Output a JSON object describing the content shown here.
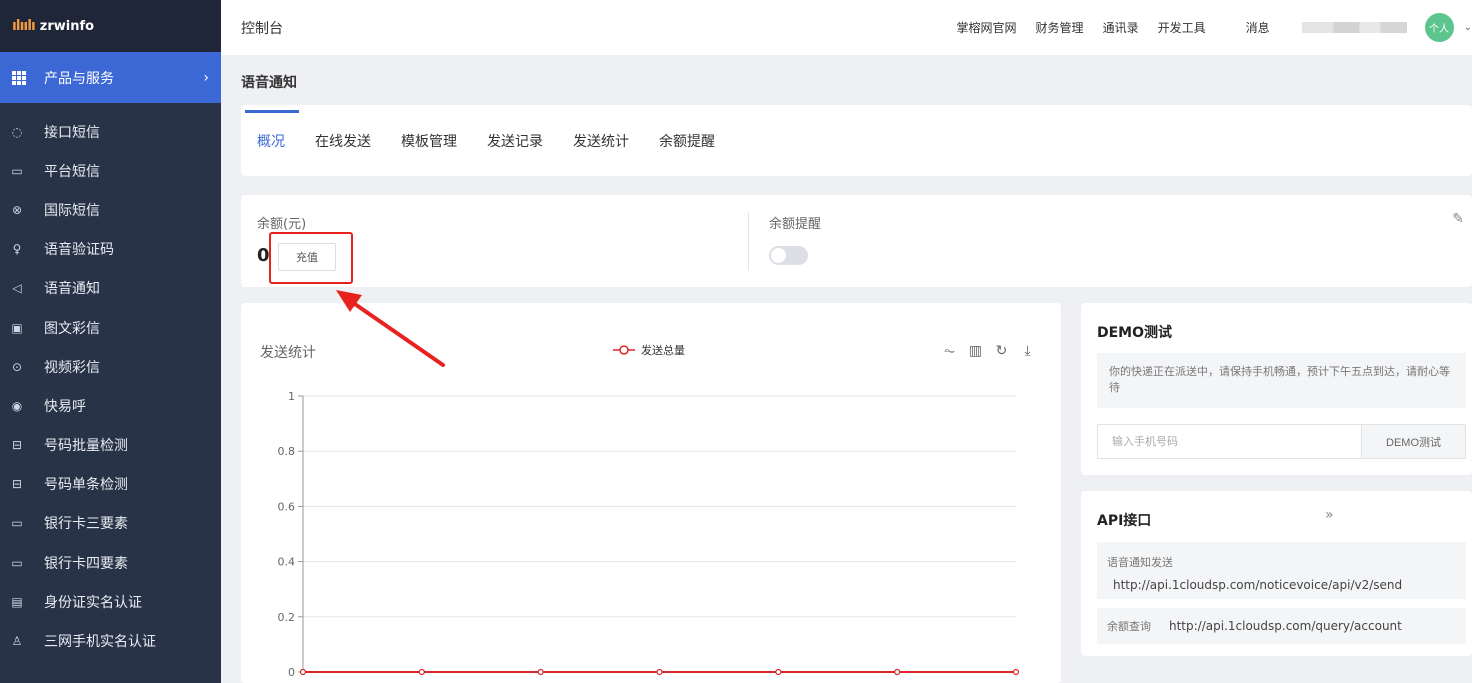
{
  "app": {
    "logo_text": "zrwinfo",
    "logo_mark": "||||H"
  },
  "sidebar": {
    "section_label": "产品与服务",
    "items": [
      {
        "label": "接口短信",
        "icon": "message-circle-icon"
      },
      {
        "label": "平台短信",
        "icon": "chat-square-icon"
      },
      {
        "label": "国际短信",
        "icon": "globe-icon"
      },
      {
        "label": "语音验证码",
        "icon": "microphone-icon"
      },
      {
        "label": "语音通知",
        "icon": "speaker-icon"
      },
      {
        "label": "图文彩信",
        "icon": "image-icon"
      },
      {
        "label": "视频彩信",
        "icon": "play-circle-icon"
      },
      {
        "label": "快易呼",
        "icon": "dial-icon"
      },
      {
        "label": "号码批量检测",
        "icon": "scan-icon"
      },
      {
        "label": "号码单条检测",
        "icon": "scan-icon"
      },
      {
        "label": "银行卡三要素",
        "icon": "card-icon"
      },
      {
        "label": "银行卡四要素",
        "icon": "card-icon"
      },
      {
        "label": "身份证实名认证",
        "icon": "id-card-icon"
      },
      {
        "label": "三网手机实名认证",
        "icon": "users-icon"
      }
    ]
  },
  "header": {
    "title": "控制台",
    "nav": [
      "掌榕网官网",
      "财务管理",
      "通讯录",
      "开发工具"
    ],
    "messages": "消息",
    "avatar_text": "个人"
  },
  "page": {
    "section_title": "语音通知"
  },
  "tabs": [
    {
      "label": "概况",
      "active": true
    },
    {
      "label": "在线发送"
    },
    {
      "label": "模板管理"
    },
    {
      "label": "发送记录"
    },
    {
      "label": "发送统计"
    },
    {
      "label": "余额提醒"
    }
  ],
  "balance": {
    "label": "余额(元)",
    "value": "0",
    "recharge_label": "充值",
    "remind_label": "余额提醒",
    "remind_on": false
  },
  "chart_data": {
    "type": "line",
    "title": "发送统计",
    "series": [
      {
        "name": "发送总量",
        "values": [
          0,
          0,
          0,
          0,
          0,
          0,
          0
        ],
        "color": "#d9282c"
      }
    ],
    "x": [
      "",
      "",
      "",
      "",
      "",
      "",
      ""
    ],
    "ylim": [
      0,
      1
    ],
    "yticks": [
      "1",
      "0.8",
      "0.6",
      "0.4",
      "0.2",
      "0"
    ],
    "grid": true,
    "legend_position": "top-center"
  },
  "demo": {
    "title": "DEMO测试",
    "description": "你的快递正在派送中，请保持手机畅通，预计下午五点到达，请耐心等待",
    "input_placeholder": "输入手机号码",
    "button_label": "DEMO测试"
  },
  "api": {
    "title": "API接口",
    "more": "»",
    "rows": [
      {
        "label": "语音通知发送",
        "url": "http://api.1cloudsp.com/noticevoice/api/v2/send"
      },
      {
        "label": "余额查询",
        "url": "http://api.1cloudsp.com/query/account"
      }
    ]
  },
  "colors": {
    "sidebar_bg": "#293347",
    "accent": "#3c68d6",
    "highlight": "#e8231f",
    "series": "#d9282c"
  }
}
